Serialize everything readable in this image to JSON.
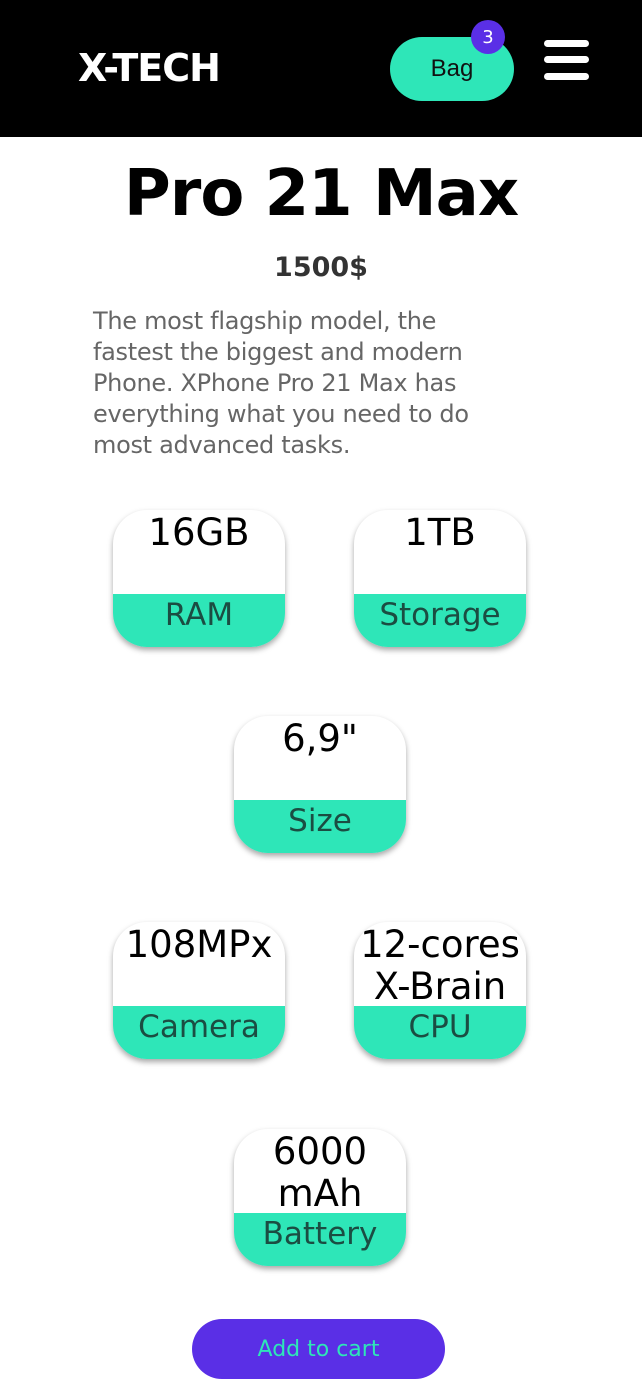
{
  "header": {
    "logo": "X-TECH",
    "bag_label": "Bag",
    "bag_count": "3",
    "menu_icon": "hamburger-menu-icon"
  },
  "product": {
    "title": "Pro 21 Max",
    "price": "1500$",
    "description": "The most flagship model, the fastest the biggest and modern Phone. XPhone Pro 21 Max has everything what you need to do most advanced tasks."
  },
  "specs": [
    {
      "value": "16GB",
      "label": "RAM"
    },
    {
      "value": "1TB",
      "label": "Storage"
    },
    {
      "value": "6,9\"",
      "label": "Size"
    },
    {
      "value": "108MPx",
      "label": "Camera"
    },
    {
      "value": "12-cores X-Brain",
      "label": "CPU"
    },
    {
      "value": "6000 mAh",
      "label": "Battery"
    }
  ],
  "actions": {
    "add_to_cart": "Add to cart"
  },
  "colors": {
    "accent": "#2ee6b8",
    "primary": "#5a2fe6",
    "header_bg": "#000000"
  }
}
